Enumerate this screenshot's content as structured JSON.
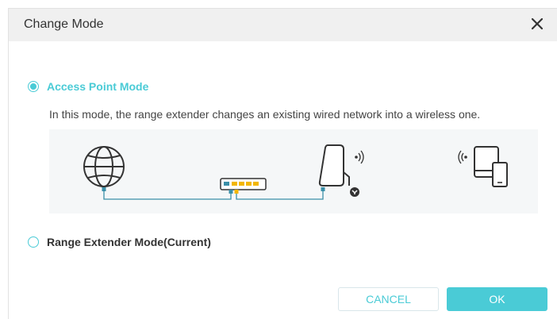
{
  "dialog": {
    "title": "Change Mode",
    "close_icon": "close-icon"
  },
  "options": [
    {
      "label": "Access Point Mode",
      "selected": true,
      "description": "In this mode, the range extender changes an existing wired network into a wireless one."
    },
    {
      "label": "Range Extender Mode(Current)",
      "selected": false
    }
  ],
  "diagram": {
    "icons": [
      "globe-icon",
      "switch-icon",
      "extender-icon",
      "wifi-signal-icon",
      "devices-icon"
    ]
  },
  "buttons": {
    "cancel": "CANCEL",
    "ok": "OK"
  },
  "colors": {
    "accent": "#4acbd6",
    "header_bg": "#f0f0f0",
    "diagram_bg": "#f5f7f8",
    "port_yellow": "#f2b600"
  }
}
